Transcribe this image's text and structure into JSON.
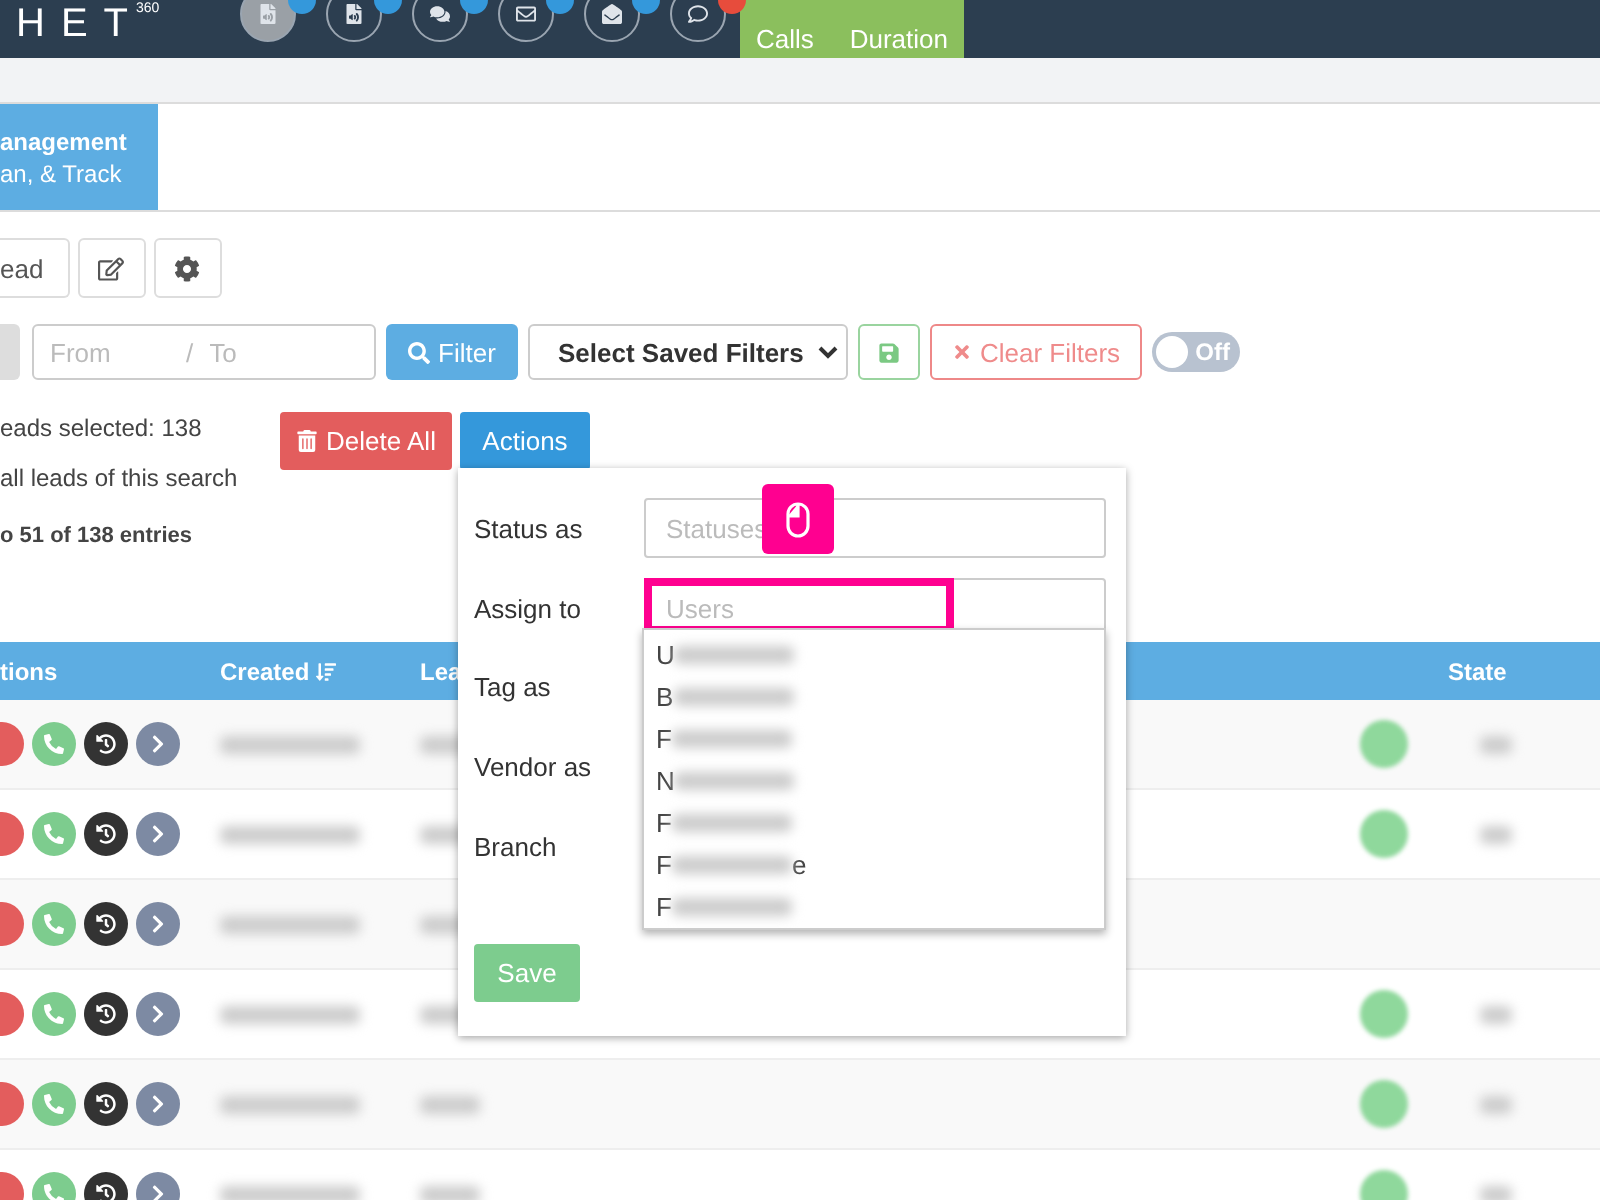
{
  "header": {
    "logo": "HET",
    "logo_superscript": "360",
    "nav_icons": [
      {
        "kind": "file",
        "selected": true,
        "color": "#3498db"
      },
      {
        "kind": "file",
        "selected": false,
        "color": "#3498db"
      },
      {
        "kind": "chat",
        "selected": false,
        "color": "#3498db"
      },
      {
        "kind": "mail",
        "selected": false,
        "color": "#3498db"
      },
      {
        "kind": "mail-open",
        "selected": false,
        "color": "#3498db"
      },
      {
        "kind": "comment",
        "selected": false,
        "color": "#e74c3c"
      }
    ],
    "stats": [
      {
        "label": "Calls"
      },
      {
        "label": "Duration"
      }
    ]
  },
  "tab": {
    "title": "anagement",
    "subtitle": "an, & Track",
    "selected": true
  },
  "toolbar": {
    "lead_button": "ead"
  },
  "filters": {
    "from_placeholder": "From",
    "separator": "/",
    "to_placeholder": "To",
    "filter_button": "Filter",
    "saved_filters": "Select Saved Filters",
    "clear_button": "Clear Filters",
    "toggle": {
      "label": "Off",
      "on": false
    }
  },
  "selection": {
    "count_text": "eads selected: 138",
    "select_all_text": "all leads of this search",
    "entries_text": "o 51 of 138 entries"
  },
  "bulk_buttons": {
    "delete": "Delete All",
    "actions": "Actions"
  },
  "actions_popover": {
    "fields": [
      {
        "label": "Status as",
        "placeholder": "Statuses",
        "highlighted": false
      },
      {
        "label": "Assign to",
        "placeholder": "Users",
        "highlighted": true
      },
      {
        "label": "Tag as"
      },
      {
        "label": "Vendor as"
      },
      {
        "label": "Branch"
      }
    ],
    "options": [
      {
        "initial": "U"
      },
      {
        "initial": "B"
      },
      {
        "initial": "F"
      },
      {
        "initial": "N"
      },
      {
        "initial": "F"
      },
      {
        "initial": "F",
        "ending": "e"
      },
      {
        "initial": "F"
      }
    ],
    "save": "Save"
  },
  "table": {
    "columns": [
      "tions",
      "Created",
      "Lea",
      "State"
    ],
    "rows": [
      {
        "status_dot": true
      },
      {
        "status_dot": true
      },
      {
        "status_dot": false
      },
      {
        "status_dot": true
      },
      {
        "status_dot": true
      },
      {
        "status_dot": true
      }
    ]
  }
}
